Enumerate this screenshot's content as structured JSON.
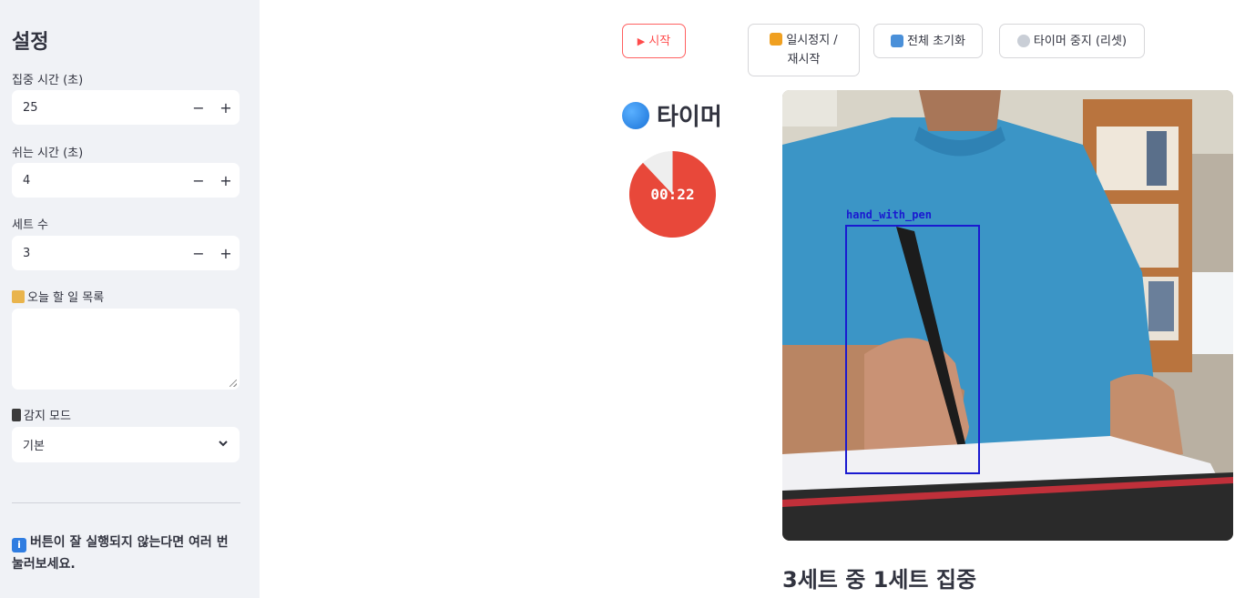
{
  "sidebar": {
    "title": "설정",
    "focus_label": "집중 시간 (초)",
    "focus_value": "25",
    "rest_label": "쉬는 시간 (초)",
    "rest_value": "4",
    "sets_label": "세트 수",
    "sets_value": "3",
    "todo_label": "오늘 할 일 목록",
    "todo_icon": "scroll-icon",
    "mode_label": "감지 모드",
    "mode_icon": "mobile-phone-icon",
    "mode_value": "기본",
    "note": "버튼이 잘 실행되지 않는다면 여러 번 눌러보세요.",
    "note_icon": "info-icon",
    "minus": "−",
    "plus": "+",
    "chevron": "⌄"
  },
  "toolbar": {
    "start_label": "시작",
    "start_icon": "play-icon",
    "pause_label_line1": "일시정지 /",
    "pause_label_line2": "재시작",
    "pause_icon": "play-pause-icon",
    "reset_all_label": "전체 초기화",
    "reset_all_icon": "refresh-icon",
    "stop_timer_label": "타이머 중지 (리셋)",
    "stop_timer_icon": "stopwatch-icon"
  },
  "timer": {
    "title": "타이머",
    "title_icon": "blue-circle-icon",
    "display": "00:22",
    "remaining_fraction": 0.88,
    "colors": {
      "remaining": "#e8483a",
      "elapsed": "#eeeeee"
    }
  },
  "camera": {
    "detection_label": "hand_with_pen"
  },
  "status": {
    "text": "3세트 중 1세트 집중"
  },
  "colors": {
    "accent": "#ff4b4b",
    "sidebar_bg": "#f0f2f6"
  }
}
